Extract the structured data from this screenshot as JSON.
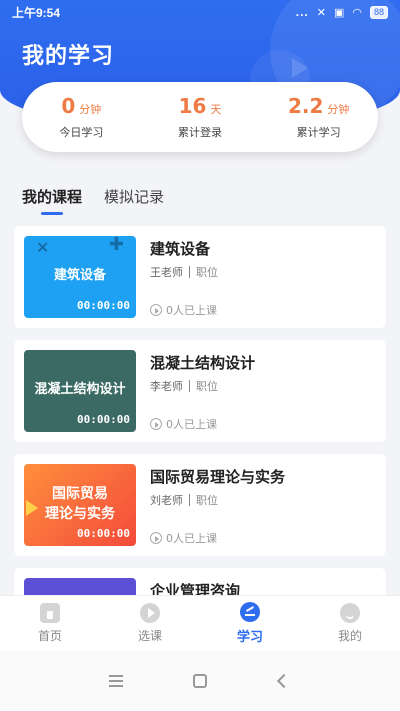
{
  "status_bar": {
    "time": "上午9:54",
    "dots": "...",
    "battery": "88"
  },
  "header": {
    "title": "我的学习"
  },
  "stats": [
    {
      "value": "0",
      "unit": "分钟",
      "label": "今日学习"
    },
    {
      "value": "16",
      "unit": "天",
      "label": "累计登录"
    },
    {
      "value": "2.2",
      "unit": "分钟",
      "label": "累计学习"
    }
  ],
  "tabs": [
    {
      "label": "我的课程"
    },
    {
      "label": "模拟记录"
    }
  ],
  "courses": [
    {
      "thumb_text": "建筑设备",
      "thumb_time": "00:00:00",
      "title": "建筑设备",
      "teacher": "王老师",
      "position": "职位",
      "learners": "0人已上课"
    },
    {
      "thumb_text": "混凝土结构设计",
      "thumb_time": "00:00:00",
      "title": "混凝土结构设计",
      "teacher": "李老师",
      "position": "职位",
      "learners": "0人已上课"
    },
    {
      "thumb_text": "国际贸易\n理论与实务",
      "thumb_time": "00:00:00",
      "title": "国际贸易理论与实务",
      "teacher": "刘老师",
      "position": "职位",
      "learners": "0人已上课"
    },
    {
      "thumb_text": "",
      "thumb_time": "",
      "title": "企业管理咨询",
      "teacher": "",
      "position": "",
      "learners": ""
    }
  ],
  "bottom_nav": [
    {
      "label": "首页",
      "icon": "home-icon"
    },
    {
      "label": "选课",
      "icon": "play-icon"
    },
    {
      "label": "学习",
      "icon": "study-icon"
    },
    {
      "label": "我的",
      "icon": "profile-icon"
    }
  ],
  "colors": {
    "brand_blue": "#2f6df0",
    "accent_orange": "#ee7a44"
  }
}
